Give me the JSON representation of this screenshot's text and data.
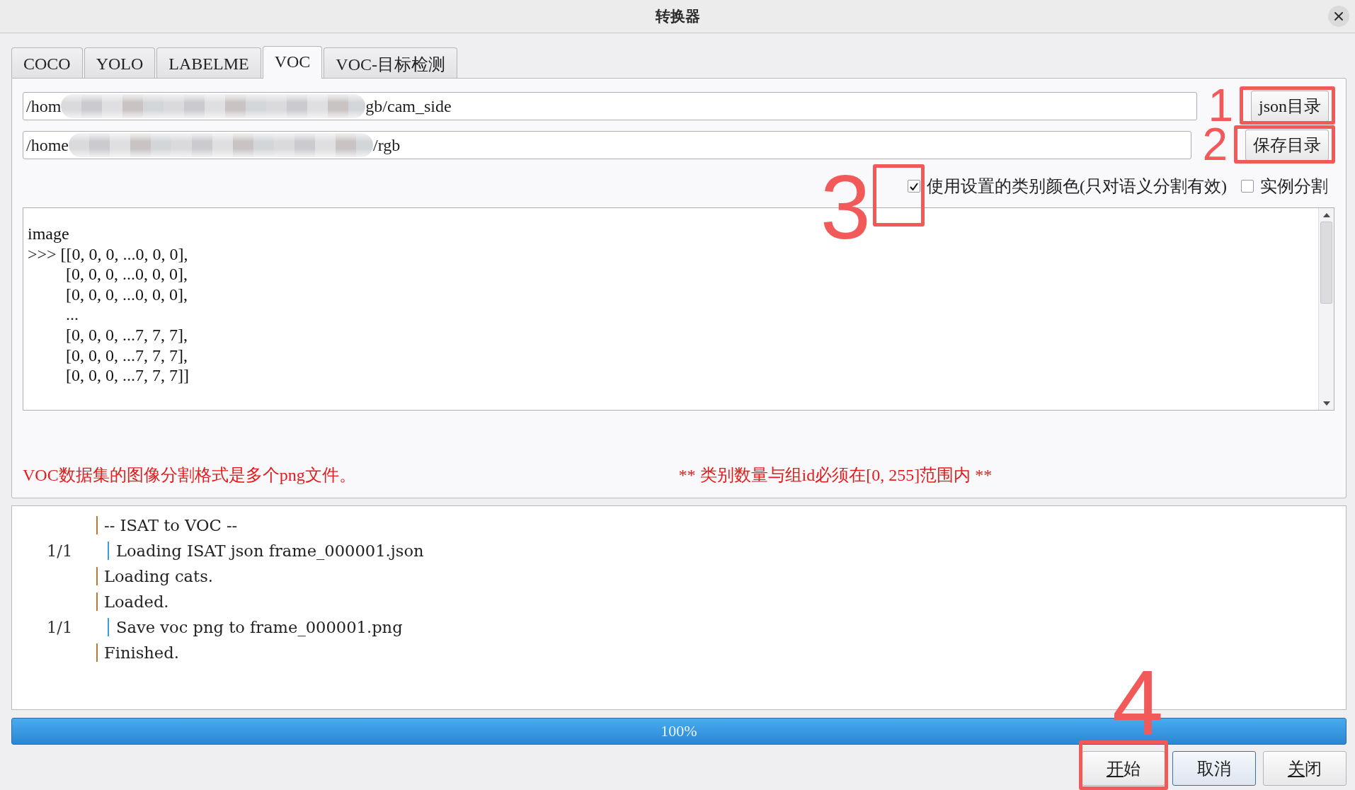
{
  "window": {
    "title": "转换器"
  },
  "tabs": [
    {
      "label": "COCO",
      "selected": false
    },
    {
      "label": "YOLO",
      "selected": false
    },
    {
      "label": "LABELME",
      "selected": false
    },
    {
      "label": "VOC",
      "selected": true
    },
    {
      "label": "VOC-目标检测",
      "selected": false
    }
  ],
  "paths": [
    {
      "value_start": "/hom",
      "redacted": true,
      "value_end": "gb/cam_side",
      "button": {
        "label": "json目录",
        "marker": "1"
      }
    },
    {
      "value_start": "/home",
      "redacted": true,
      "value_end": "/rgb",
      "button": {
        "label": "保存目录",
        "marker": "2"
      }
    }
  ],
  "options": [
    {
      "label": "使用设置的类别颜色(只对语义分割有效)",
      "checked": true,
      "marker": "3"
    },
    {
      "label": "实例分割",
      "checked": false
    }
  ],
  "preview": {
    "text": "image\n>>> [[0, 0, 0, ...0, 0, 0],\n         [0, 0, 0, ...0, 0, 0],\n         [0, 0, 0, ...0, 0, 0],\n         ...\n         [0, 0, 0, ...7, 7, 7],\n         [0, 0, 0, ...7, 7, 7],\n         [0, 0, 0, ...7, 7, 7]]"
  },
  "notes": [
    "VOC数据集的图像分割格式是多个png文件。",
    "** 类别数量与组id必须在[0, 255]范围内 **"
  ],
  "log": [
    {
      "kind": "step",
      "text": "-- ISAT to VOC --"
    },
    {
      "kind": "progress",
      "count": "1/1",
      "text": "Loading ISAT json frame_000001.json"
    },
    {
      "kind": "step",
      "text": "Loading cats."
    },
    {
      "kind": "step",
      "text": "Loaded."
    },
    {
      "kind": "progress",
      "count": "1/1",
      "text": "Save voc png to frame_000001.png"
    },
    {
      "kind": "step",
      "text": "Finished."
    }
  ],
  "progress": {
    "level": 1,
    "text": "100%"
  },
  "buttons": [
    {
      "label": "开始",
      "shortcut": true,
      "default": false,
      "marker": "4"
    },
    {
      "label": "取消",
      "shortcut": false,
      "default": true
    },
    {
      "label": "关闭",
      "shortcut": true,
      "default": false
    }
  ]
}
